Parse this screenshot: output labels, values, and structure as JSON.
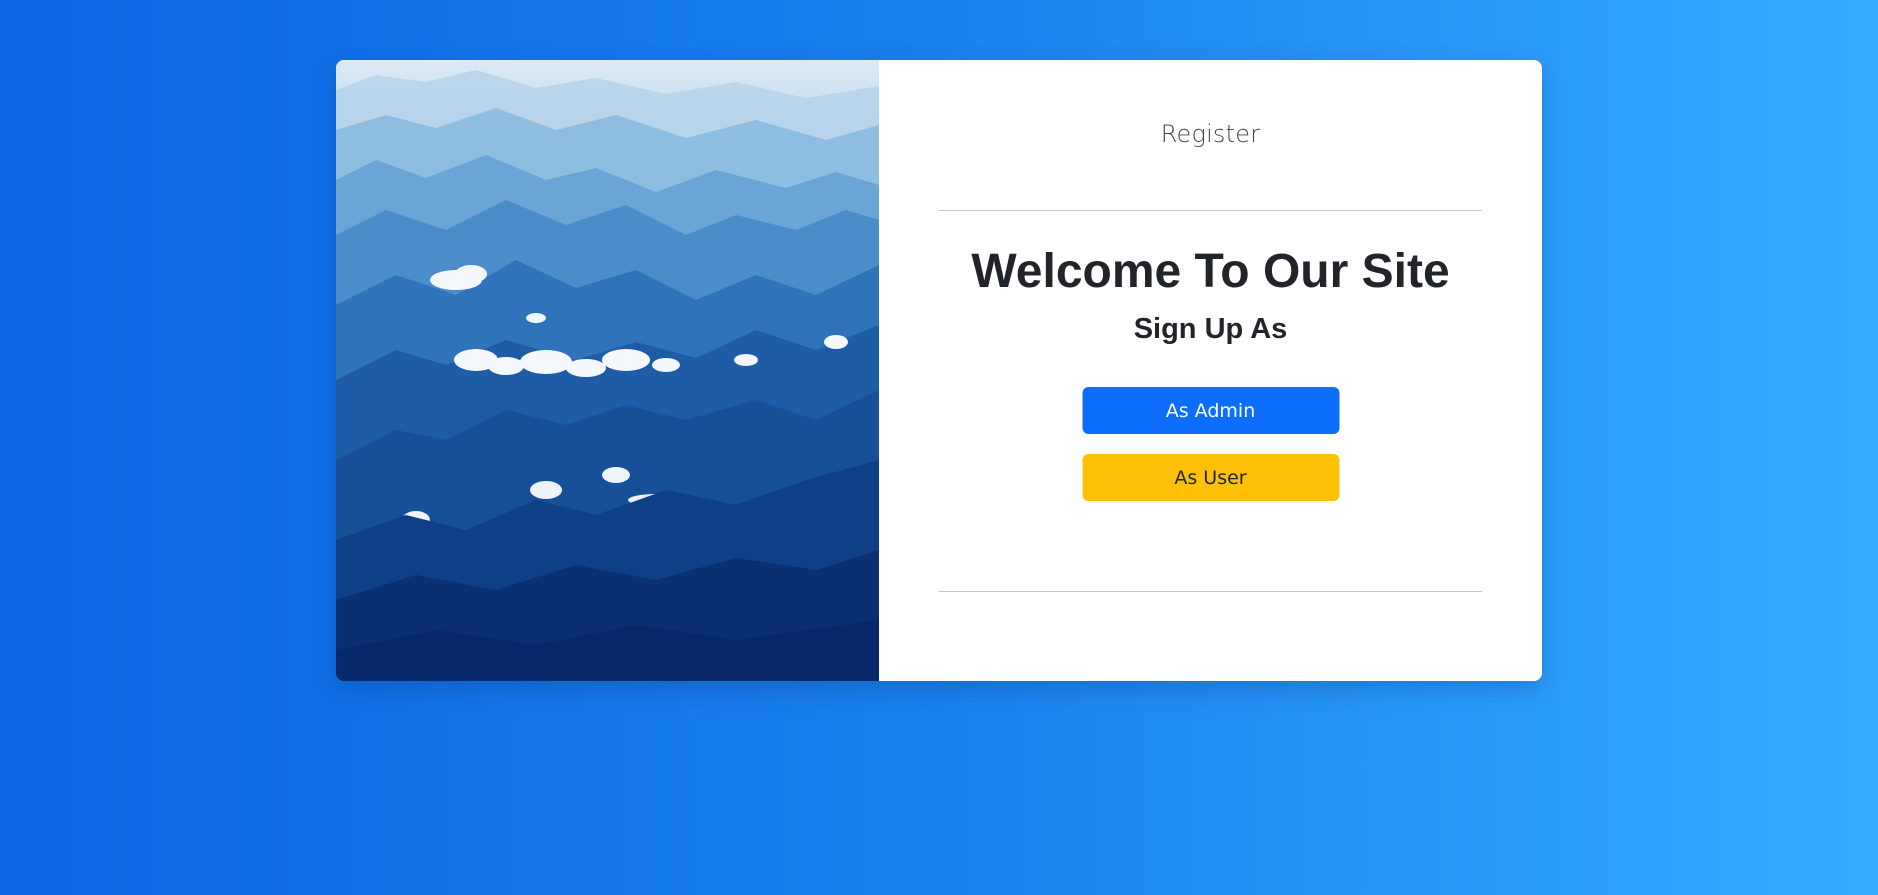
{
  "register": {
    "label": "Register"
  },
  "main": {
    "heading": "Welcome To Our Site",
    "subheading": "Sign Up As"
  },
  "buttons": {
    "admin_label": "As Admin",
    "user_label": "As User"
  },
  "colors": {
    "admin_button": "#0d6efd",
    "user_button": "#ffc107",
    "background_gradient_start": "#0a66e4",
    "background_gradient_end": "#36aaff"
  },
  "image": {
    "semantic": "mountain-landscape-image"
  }
}
